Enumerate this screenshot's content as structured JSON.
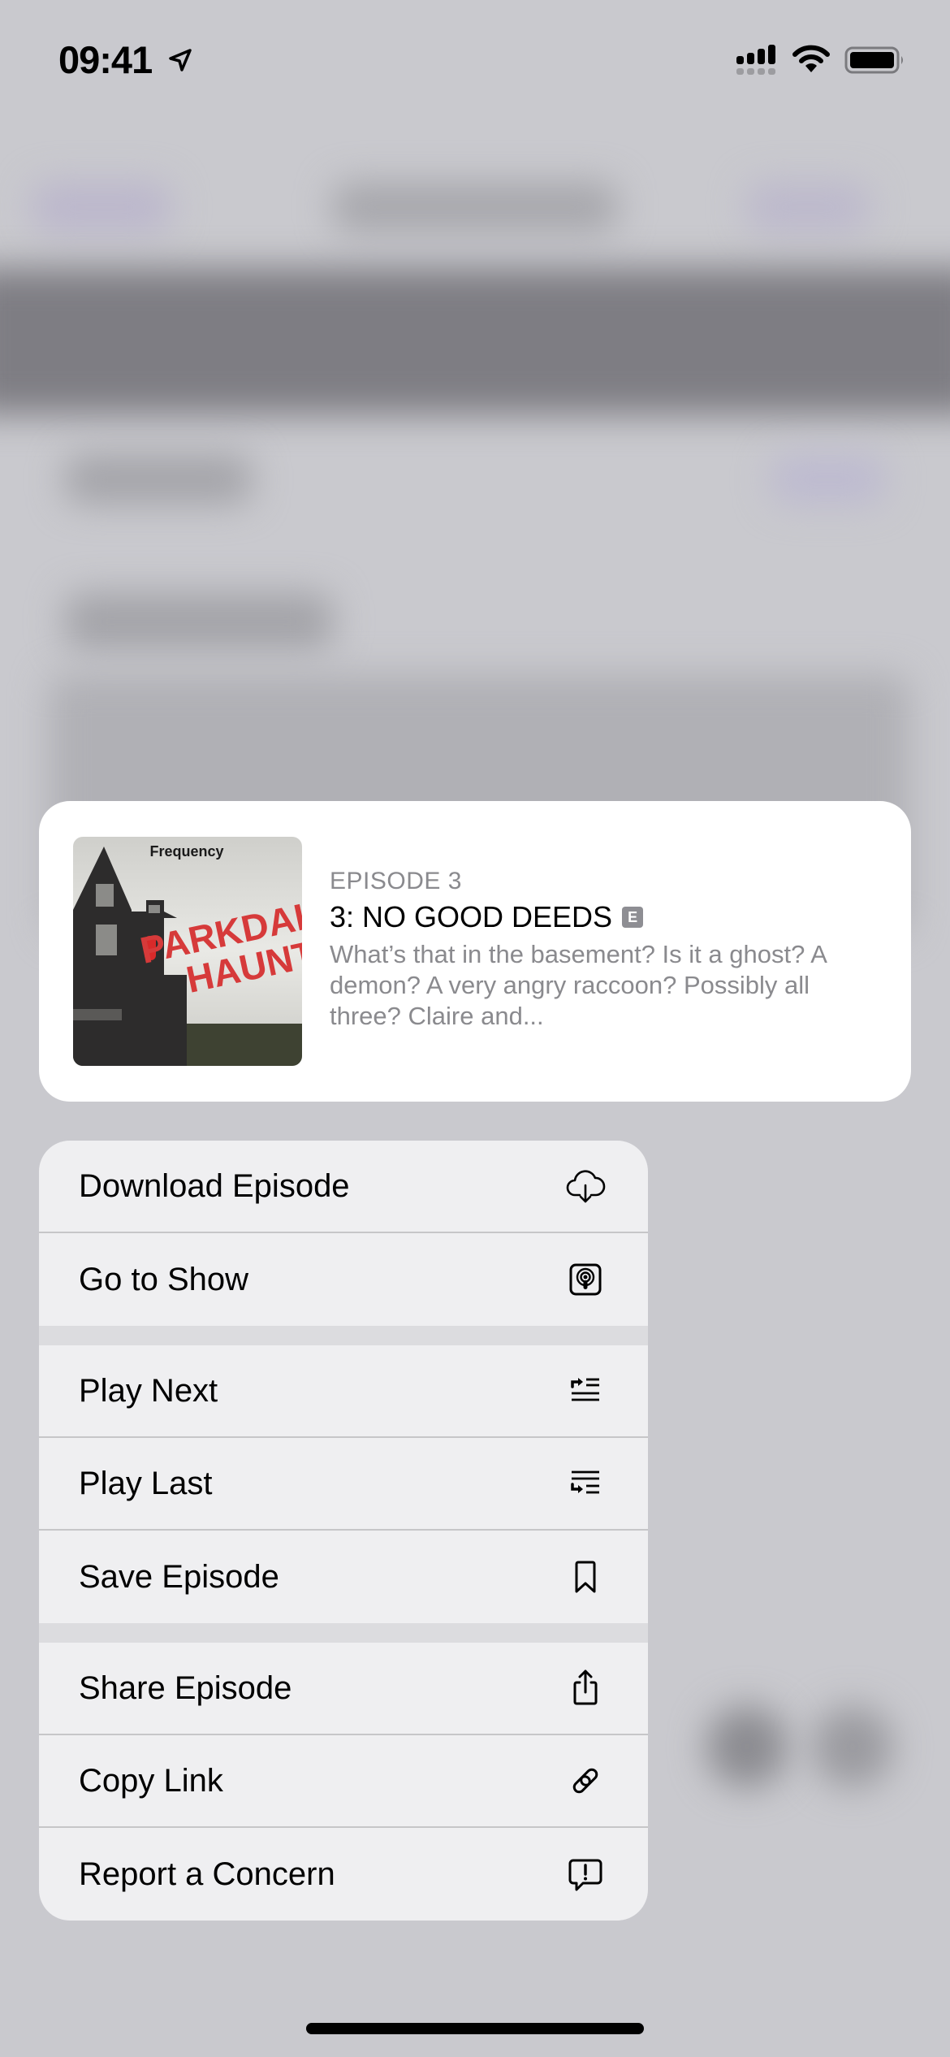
{
  "status_bar": {
    "time": "09:41",
    "icons": [
      "location-arrow-icon",
      "cellular-signal-icon",
      "wifi-icon",
      "battery-icon"
    ]
  },
  "preview": {
    "artwork": {
      "publisher": "Frequency",
      "show_title_line1": "PARKDALE",
      "show_title_line2": "HAUNT"
    },
    "episode_label": "EPISODE 3",
    "episode_title": "3: NO GOOD DEEDS",
    "explicit_badge": "E",
    "description": "What’s that in the basement? Is it a ghost? A demon? A very angry raccoon? Possibly all three? Claire and..."
  },
  "menu": {
    "groups": [
      [
        {
          "label": "Download Episode",
          "icon": "cloud-download-icon"
        },
        {
          "label": "Go to Show",
          "icon": "podcasts-app-icon"
        }
      ],
      [
        {
          "label": "Play Next",
          "icon": "play-next-icon"
        },
        {
          "label": "Play Last",
          "icon": "play-last-icon"
        },
        {
          "label": "Save Episode",
          "icon": "bookmark-icon"
        }
      ],
      [
        {
          "label": "Share Episode",
          "icon": "share-icon"
        },
        {
          "label": "Copy Link",
          "icon": "link-icon"
        },
        {
          "label": "Report a Concern",
          "icon": "report-concern-icon"
        }
      ]
    ]
  },
  "colors": {
    "background": "#c9c9ce",
    "menu_background": "#efeff1",
    "separator": "#c6c6c8",
    "secondary_text": "#8a8a8e",
    "artwork_red": "#d63a3a"
  }
}
